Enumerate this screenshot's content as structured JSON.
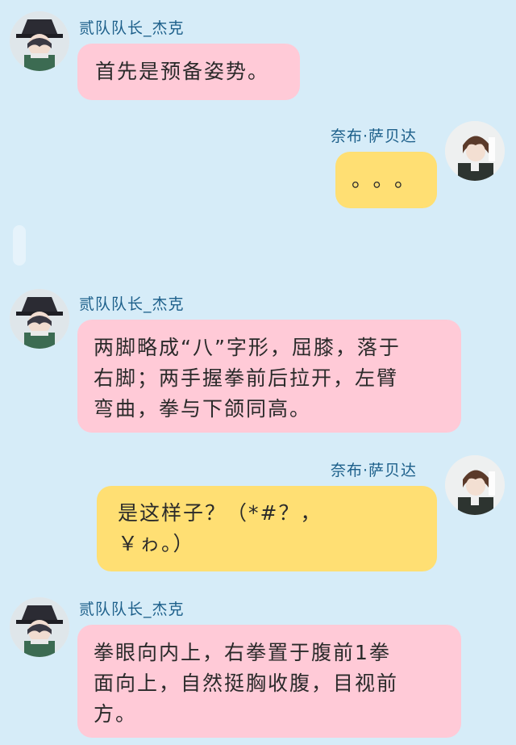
{
  "messages": [
    {
      "side": "left",
      "sender": "贰队队长_杰克",
      "text": "首先是预备姿势。",
      "avatar": "avatar-jack"
    },
    {
      "side": "right",
      "sender": "奈布·萨贝达",
      "text": "。。。",
      "avatar": "avatar-naib"
    },
    {
      "side": "left",
      "sender": "贰队队长_杰克",
      "lines": [
        "两脚略成“八”字形，屈膝，落于",
        "右脚；两手握拳前后拉开，左臂",
        "弯曲，拳与下颌同高。"
      ],
      "avatar": "avatar-jack"
    },
    {
      "side": "right",
      "sender": "奈布·萨贝达",
      "lines": [
        "是这样子？（*#？，",
        "￥ゎ。）"
      ],
      "avatar": "avatar-naib"
    },
    {
      "side": "left",
      "sender": "贰队队长_杰克",
      "lines": [
        "拳眼向内上，右拳置于腹前1拳",
        "面向上，自然挺胸收腹，目视前",
        "方。"
      ],
      "avatar": "avatar-jack"
    }
  ],
  "colors": {
    "background": "#d6ecf8",
    "left_bubble": "#ffcad7",
    "right_bubble": "#ffdf73",
    "name": "#1c5f8a"
  }
}
